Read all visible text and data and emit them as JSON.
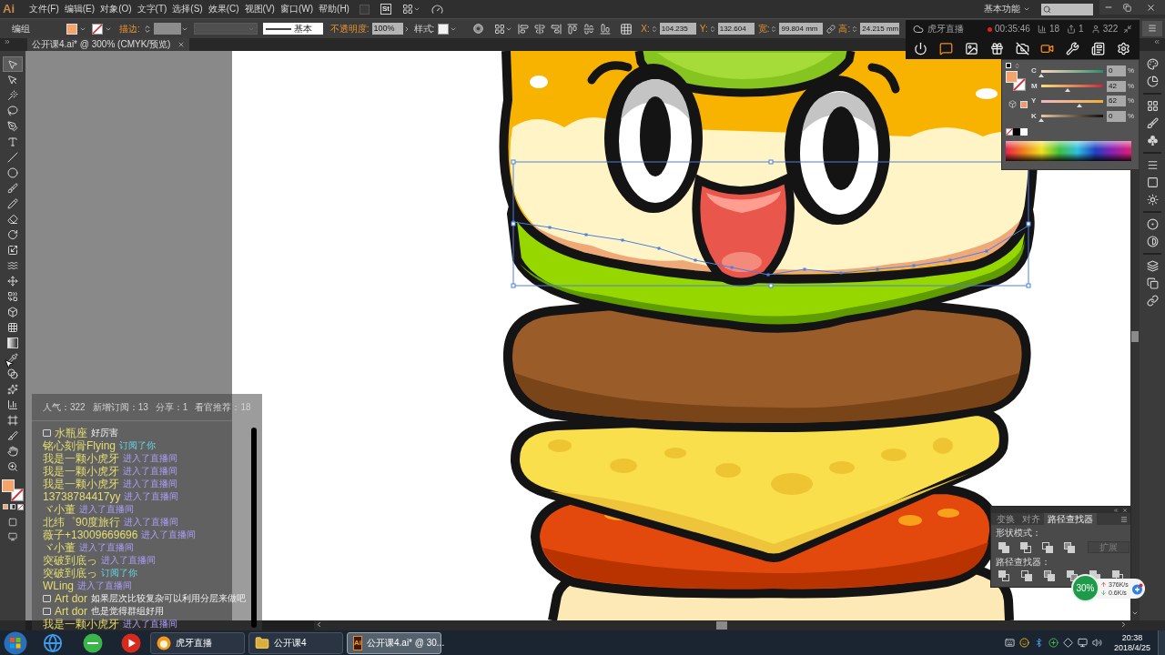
{
  "app_logo": "Ai",
  "menu_bar": {
    "items": [
      "文件(F)",
      "编辑(E)",
      "对象(O)",
      "文字(T)",
      "选择(S)",
      "效果(C)",
      "视图(V)",
      "窗口(W)",
      "帮助(H)"
    ],
    "stock_badge": "St",
    "workspace": "基本功能"
  },
  "control_bar": {
    "selection": "编组",
    "stroke_label": "描边:",
    "profile": "基本",
    "opacity_label": "不透明度:",
    "opacity": "100%",
    "style_label": "样式:",
    "transform": [
      {
        "label": "X:",
        "value": "104.235"
      },
      {
        "label": "Y:",
        "value": "132.604"
      },
      {
        "label": "宽:",
        "value": "99.804 mm"
      },
      {
        "label": "高:",
        "value": "24.215 mm"
      }
    ]
  },
  "document_tab": {
    "title": "公开课4.ai* @ 300% (CMYK/预览)"
  },
  "tools": [
    {
      "kind": "selection",
      "selected": true
    },
    {
      "kind": "direct-selection",
      "selected": false
    },
    {
      "kind": "magic-wand",
      "selected": false
    },
    {
      "kind": "lasso",
      "selected": false
    },
    {
      "kind": "pen",
      "selected": false
    },
    {
      "kind": "type",
      "selected": false
    },
    {
      "kind": "line",
      "selected": false
    },
    {
      "kind": "ellipse",
      "selected": false
    },
    {
      "kind": "paintbrush",
      "selected": false
    },
    {
      "kind": "pencil",
      "selected": false
    },
    {
      "kind": "eraser",
      "selected": false
    },
    {
      "kind": "rotate",
      "selected": false
    },
    {
      "kind": "scale",
      "selected": false
    },
    {
      "kind": "warp",
      "selected": false
    },
    {
      "kind": "free-transform",
      "selected": false
    },
    {
      "kind": "shape-builder",
      "selected": false
    },
    {
      "kind": "perspective",
      "selected": false
    },
    {
      "kind": "mesh",
      "selected": false
    },
    {
      "kind": "gradient",
      "selected": false
    },
    {
      "kind": "eyedropper",
      "selected": false
    },
    {
      "kind": "blend",
      "selected": false
    },
    {
      "kind": "symbol",
      "selected": false
    },
    {
      "kind": "graph",
      "selected": false
    },
    {
      "kind": "artboard",
      "selected": false
    },
    {
      "kind": "slice",
      "selected": false
    },
    {
      "kind": "hand",
      "selected": false
    },
    {
      "kind": "zoom",
      "selected": false
    }
  ],
  "stream_overlay": {
    "title": "虎牙直播",
    "timer": "00:35:46",
    "stats": [
      {
        "kind": "chart",
        "value": "18"
      },
      {
        "kind": "share",
        "value": "1"
      },
      {
        "kind": "viewers",
        "value": "322"
      }
    ],
    "buttons": [
      {
        "kind": "power",
        "active": false
      },
      {
        "kind": "chat",
        "active": true
      },
      {
        "kind": "image",
        "active": false
      },
      {
        "kind": "gift",
        "active": false
      },
      {
        "kind": "camera-off",
        "active": false
      },
      {
        "kind": "camera",
        "active": true
      },
      {
        "kind": "wrench",
        "active": false
      },
      {
        "kind": "newspaper",
        "active": false
      },
      {
        "kind": "settings",
        "active": false
      }
    ]
  },
  "color_panel": {
    "channels": [
      {
        "name": "C",
        "level": 0,
        "value": "0",
        "unit": "%"
      },
      {
        "name": "M",
        "level": 0.42,
        "value": "42",
        "unit": "%"
      },
      {
        "name": "Y",
        "level": 0.62,
        "value": "62",
        "unit": "%"
      },
      {
        "name": "K",
        "level": 0,
        "value": "0",
        "unit": "%"
      }
    ]
  },
  "chat_panel": {
    "stats": [
      "人气：322",
      "新增订阅：13",
      "分享：1",
      "看官推荐：18"
    ],
    "messages": [
      {
        "kind": "chat",
        "user": "水瓶座",
        "text": "好厉害"
      },
      {
        "kind": "subscribe",
        "user": "铭心刻骨Flying",
        "text": "订阅了你"
      },
      {
        "kind": "enter",
        "user": "我是一颗小虎牙",
        "text": "进入了直播间"
      },
      {
        "kind": "enter",
        "user": "我是一颗小虎牙",
        "text": "进入了直播间"
      },
      {
        "kind": "enter",
        "user": "我是一颗小虎牙",
        "text": "进入了直播间"
      },
      {
        "kind": "enter",
        "user": "13738784417yy",
        "text": "进入了直播间"
      },
      {
        "kind": "enter",
        "user": "ヾ小董",
        "text": "进入了直播间"
      },
      {
        "kind": "enter",
        "user": "北纬゜90度旅行",
        "text": "进入了直播间"
      },
      {
        "kind": "enter",
        "user": "薇子+13009669696",
        "text": "进入了直播间"
      },
      {
        "kind": "enter",
        "user": "ヾ小董",
        "text": "进入了直播间"
      },
      {
        "kind": "enter",
        "user": "突破到底っ",
        "text": "进入了直播间"
      },
      {
        "kind": "subscribe",
        "user": "突破到底っ",
        "text": "订阅了你"
      },
      {
        "kind": "enter",
        "user": "WLing",
        "text": "进入了直播间"
      },
      {
        "kind": "chat",
        "user": "Art dor",
        "text": "如果层次比较复杂可以利用分层来做吧"
      },
      {
        "kind": "chat",
        "user": "Art dor",
        "text": "也是觉得群组好用"
      },
      {
        "kind": "enter",
        "user": "我是一颗小虎牙",
        "text": "进入了直播间"
      }
    ]
  },
  "pathfinder_panel": {
    "tabs": [
      {
        "label": "变换",
        "selected": false
      },
      {
        "label": "对齐",
        "selected": false
      },
      {
        "label": "路径查找器",
        "selected": true
      }
    ],
    "shape_modes_label": "形状模式：",
    "expand_button": {
      "label": "扩展",
      "disabled": true
    },
    "pathfinders_label": "路径查找器："
  },
  "network_widget": {
    "load": "30%",
    "upload": "376K/s",
    "download": "0.6K/s"
  },
  "taskbar": {
    "tasks": [
      {
        "kind": "huya",
        "label": "虎牙直播",
        "selected": false
      },
      {
        "kind": "folder",
        "label": "公开课4",
        "selected": false
      },
      {
        "kind": "illustrator",
        "icon_text": "Ai",
        "label": "公开课4.ai* @ 30...",
        "selected": true
      }
    ],
    "time": "20:38",
    "date": "2018/4/25"
  }
}
